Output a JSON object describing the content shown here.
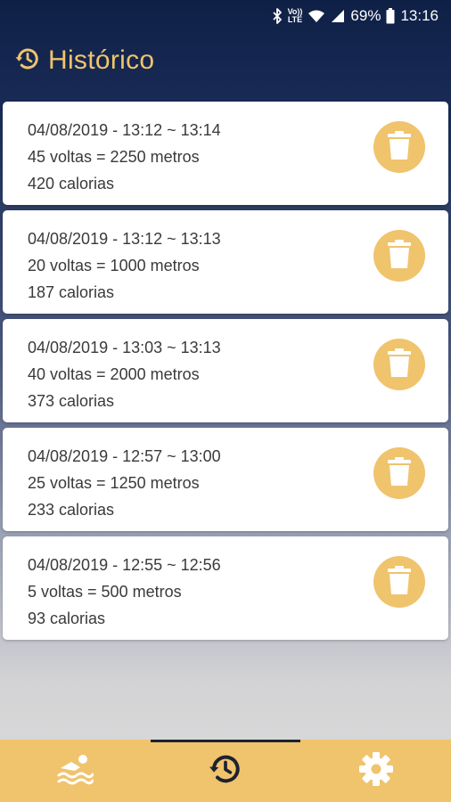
{
  "status_bar": {
    "volte_top": "Vo))",
    "volte_bottom": "LTE",
    "battery": "69%",
    "time": "13:16",
    "icons": [
      "bluetooth-icon",
      "volte-icon",
      "wifi-icon",
      "signal-icon",
      "battery-icon"
    ]
  },
  "header": {
    "icon": "history-icon",
    "title": "Histórico"
  },
  "sessions": [
    {
      "date_time": "04/08/2019 - 13:12 ~ 13:14",
      "laps": "45 voltas = 2250 metros",
      "calories": "420 calorias"
    },
    {
      "date_time": "04/08/2019 - 13:12 ~ 13:13",
      "laps": "20 voltas = 1000 metros",
      "calories": "187 calorias"
    },
    {
      "date_time": "04/08/2019 - 13:03 ~ 13:13",
      "laps": "40 voltas = 2000 metros",
      "calories": "373 calorias"
    },
    {
      "date_time": "04/08/2019 - 12:57 ~ 13:00",
      "laps": "25 voltas = 1250 metros",
      "calories": "233 calorias"
    },
    {
      "date_time": "04/08/2019 - 12:55 ~ 12:56",
      "laps": "5 voltas = 500 metros",
      "calories": "93 calorias"
    }
  ],
  "delete_icon": "trash-icon",
  "bottom_nav": {
    "items": [
      {
        "icon": "swimmer-icon",
        "active": false
      },
      {
        "icon": "history-icon",
        "active": true
      },
      {
        "icon": "gear-icon",
        "active": false
      }
    ]
  },
  "colors": {
    "accent": "#f0c36d",
    "header_bg": "#0f2046",
    "card_bg": "#ffffff",
    "text": "#3a3a3a",
    "nav_icon": "#ffffff",
    "nav_active_icon": "#1d2230"
  }
}
